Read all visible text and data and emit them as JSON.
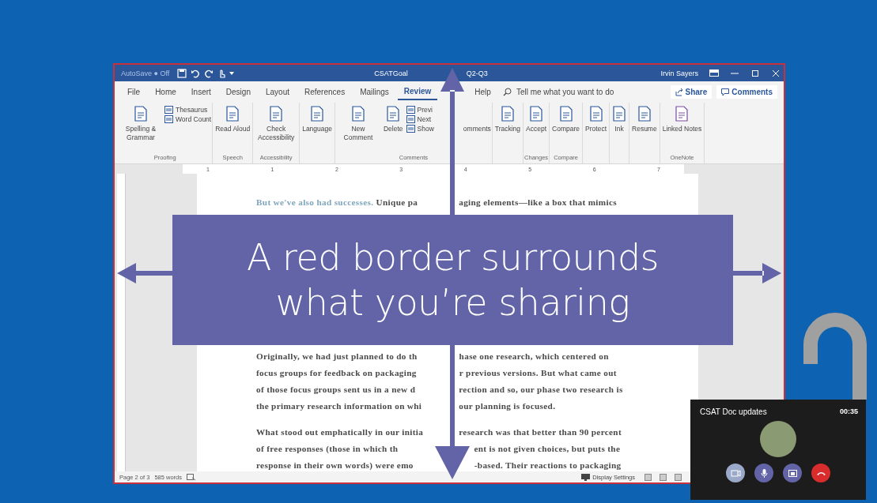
{
  "word_window": {
    "autosave": "AutoSave ● Off",
    "title": "CSATGoal",
    "title_rest": "Q2-Q3",
    "user": "Irvin Sayers",
    "tabs": [
      {
        "label": "File",
        "selected": false
      },
      {
        "label": "Home",
        "selected": false
      },
      {
        "label": "Insert",
        "selected": false
      },
      {
        "label": "Design",
        "selected": false
      },
      {
        "label": "Layout",
        "selected": false
      },
      {
        "label": "References",
        "selected": false
      },
      {
        "label": "Mailings",
        "selected": false
      },
      {
        "label": "Review",
        "selected": true
      },
      {
        "label": "Help",
        "selected": false
      }
    ],
    "search": {
      "placeholder": "Tell me what you want to do"
    },
    "share": "Share",
    "comments": "Comments",
    "ribbon": [
      {
        "label": "Proofing",
        "buttons": [
          {
            "kind": "large",
            "label": "Spelling & Grammar"
          },
          {
            "kind": "small",
            "label": "Thesaurus"
          },
          {
            "kind": "small",
            "label": "Word Count"
          }
        ]
      },
      {
        "label": "Speech",
        "buttons": [
          {
            "kind": "large",
            "label": "Read Aloud"
          }
        ]
      },
      {
        "label": "Accessibility",
        "buttons": [
          {
            "kind": "large",
            "label": "Check Accessibility"
          }
        ]
      },
      {
        "buttons": [
          {
            "kind": "large",
            "label": "Language"
          }
        ]
      },
      {
        "label": "Comments",
        "buttons": [
          {
            "kind": "large",
            "label": "New Comment"
          },
          {
            "kind": "large",
            "label": "Delete"
          },
          {
            "kind": "small",
            "label": "Previ"
          },
          {
            "kind": "small",
            "label": "Next"
          },
          {
            "kind": "small",
            "label": "Show",
            "label_rest": "omments"
          }
        ]
      },
      {
        "buttons": [
          {
            "kind": "large",
            "label": "Tracking"
          }
        ]
      },
      {
        "label": "Changes",
        "buttons": [
          {
            "kind": "large",
            "label": "Accept"
          }
        ]
      },
      {
        "label": "Compare",
        "buttons": [
          {
            "kind": "large",
            "label": "Compare"
          }
        ]
      },
      {
        "buttons": [
          {
            "kind": "large",
            "label": "Protect"
          }
        ]
      },
      {
        "buttons": [
          {
            "kind": "large",
            "label": "Ink"
          }
        ]
      },
      {
        "buttons": [
          {
            "kind": "large",
            "label": "Resume"
          }
        ]
      },
      {
        "label": "OneNote",
        "buttons": [
          {
            "kind": "large",
            "label": "Linked Notes"
          }
        ]
      }
    ],
    "ruler": [
      "1",
      "1",
      "2",
      "3",
      "4",
      "5",
      "6",
      "7"
    ],
    "document": [
      {
        "lines": [
          {
            "lead": "But we've also had successes.",
            "left": "Unique pa",
            "right": "aging elements—like a box that mimics"
          }
        ]
      },
      {
        "lines": [
          {
            "left": "Originally, we had just planned to do th",
            "right": "hase one research, which centered on"
          },
          {
            "left": "focus groups for feedback on packaging",
            "right": "r previous versions. But what came out"
          },
          {
            "left": "of those focus groups sent us in a new d",
            "right": "rection and so, our phase two research is"
          },
          {
            "left": "the primary research information on whi",
            "right": "our planning is focused."
          }
        ]
      },
      {
        "lines": [
          {
            "left": "What stood out emphatically in our initia",
            "right": "research was that better than 90 percent"
          },
          {
            "left": "of free responses (those in which th",
            "right": "ent is not given choices, but puts the"
          },
          {
            "left": "response in their own words) were emo",
            "right": "-based. Their reactions to packaging"
          }
        ]
      }
    ],
    "status": {
      "page": "Page 2 of 3",
      "words": "585 words",
      "display": "Display Settings"
    }
  },
  "banner": {
    "lines": [
      "A red border surrounds",
      "what you’re sharing"
    ]
  },
  "call": {
    "title": "CSAT Doc updates",
    "time": "00:35",
    "buttons": [
      {
        "kind": "video",
        "disabled": true
      },
      {
        "kind": "mic",
        "disabled": false
      },
      {
        "kind": "share",
        "disabled": false
      },
      {
        "kind": "hangup",
        "disabled": false
      }
    ]
  }
}
